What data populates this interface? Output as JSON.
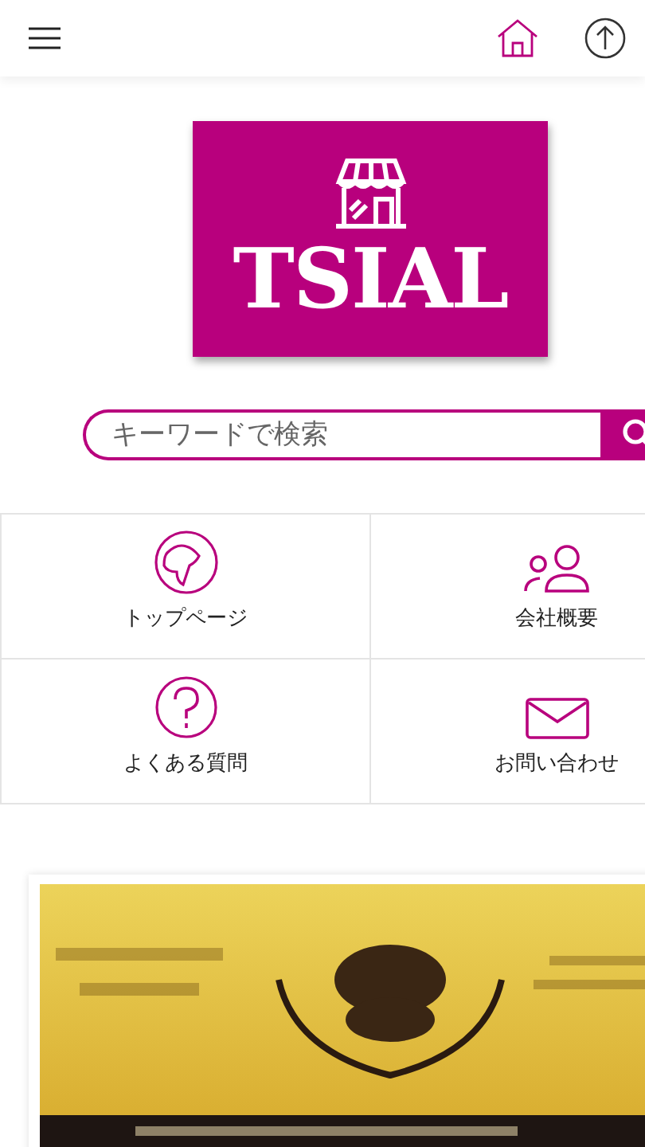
{
  "logo": {
    "text": "TSIAL"
  },
  "search": {
    "placeholder": "キーワードで検索"
  },
  "menu": [
    {
      "kind": "globe",
      "label": "トップページ"
    },
    {
      "kind": "people",
      "label": "会社概要"
    },
    {
      "kind": "question",
      "label": "よくある質問"
    },
    {
      "kind": "mail",
      "label": "お問い合わせ"
    }
  ]
}
